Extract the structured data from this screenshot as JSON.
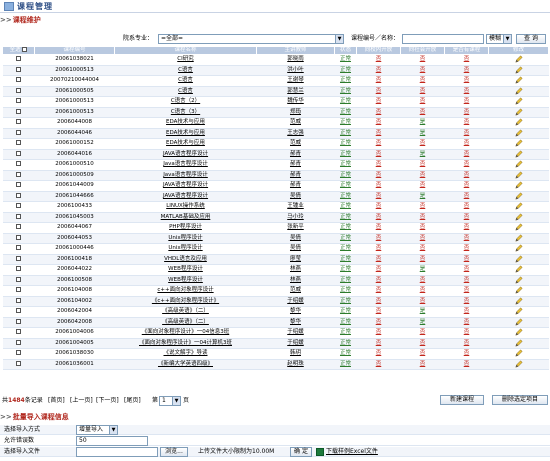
{
  "app_title": "课程管理",
  "section_maintain": "课程维护",
  "filter": {
    "dept_label": "院系专业：",
    "dept_value": "=全部=",
    "search_label": "课程编号／名称：",
    "mode_value": "模糊",
    "search_button": "查 询"
  },
  "table": {
    "headers": [
      "全选",
      "课程编号",
      "课程名称",
      "主讲教师",
      "状态",
      "向校内开放",
      "向社会开放",
      "是否有课程",
      "修改"
    ],
    "rows": [
      {
        "id": "20061038021",
        "name": "CI研究",
        "teacher": "郭晓雨",
        "status": "正常",
        "in": "否",
        "soc": "否",
        "has": "否"
      },
      {
        "id": "20061000513",
        "name": "C语言",
        "teacher": "洪小叶",
        "status": "正常",
        "in": "否",
        "soc": "否",
        "has": "否"
      },
      {
        "id": "20070210044004",
        "name": "C语言",
        "teacher": "王谢琴",
        "status": "正常",
        "in": "否",
        "soc": "否",
        "has": "否"
      },
      {
        "id": "20061000505",
        "name": "C语言",
        "teacher": "郭慧兰",
        "status": "正常",
        "in": "否",
        "soc": "否",
        "has": "否"
      },
      {
        "id": "20061000513",
        "name": "C语言（2）",
        "teacher": "魏传华",
        "status": "正常",
        "in": "否",
        "soc": "否",
        "has": "否"
      },
      {
        "id": "20061000513",
        "name": "C语言（3）",
        "teacher": "郑筠",
        "status": "正常",
        "in": "否",
        "soc": "否",
        "has": "否"
      },
      {
        "id": "2006044008",
        "name": "EDA技术与应用",
        "teacher": "范威",
        "status": "正常",
        "in": "否",
        "soc": "是",
        "has": "否"
      },
      {
        "id": "2006044046",
        "name": "EDA技术与应用",
        "teacher": "王志强",
        "status": "正常",
        "in": "否",
        "soc": "是",
        "has": "否"
      },
      {
        "id": "20061000152",
        "name": "EDA技术与应用",
        "teacher": "范威",
        "status": "正常",
        "in": "否",
        "soc": "否",
        "has": "否"
      },
      {
        "id": "2006044016",
        "name": "JAVA语言程序设计",
        "teacher": "郝青",
        "status": "正常",
        "in": "否",
        "soc": "是",
        "has": "否"
      },
      {
        "id": "20061000510",
        "name": "Java语言程序设计",
        "teacher": "郝青",
        "status": "正常",
        "in": "否",
        "soc": "否",
        "has": "否"
      },
      {
        "id": "20061000509",
        "name": "Java语言程序设计",
        "teacher": "郝青",
        "status": "正常",
        "in": "否",
        "soc": "否",
        "has": "否"
      },
      {
        "id": "20061044009",
        "name": "JAVA语言程序设计",
        "teacher": "郝青",
        "status": "正常",
        "in": "否",
        "soc": "否",
        "has": "否"
      },
      {
        "id": "20061044666",
        "name": "JAVA语言程序设计",
        "teacher": "吴倩",
        "status": "正常",
        "in": "否",
        "soc": "是",
        "has": "否"
      },
      {
        "id": "2006100433",
        "name": "LINUX操作系统",
        "teacher": "王锺业",
        "status": "正常",
        "in": "否",
        "soc": "否",
        "has": "否"
      },
      {
        "id": "20061045003",
        "name": "MATLAB基础及应用",
        "teacher": "马小玲",
        "status": "正常",
        "in": "否",
        "soc": "否",
        "has": "否"
      },
      {
        "id": "2006044067",
        "name": "PHP程序设计",
        "teacher": "张新平",
        "status": "正常",
        "in": "否",
        "soc": "否",
        "has": "否"
      },
      {
        "id": "2006044053",
        "name": "Unix程序设计",
        "teacher": "吴倩",
        "status": "正常",
        "in": "否",
        "soc": "否",
        "has": "否"
      },
      {
        "id": "20061000446",
        "name": "Unix程序设计",
        "teacher": "吴倩",
        "status": "正常",
        "in": "否",
        "soc": "否",
        "has": "否"
      },
      {
        "id": "2006100418",
        "name": "VHDL语言及应用",
        "teacher": "廖莹",
        "status": "正常",
        "in": "否",
        "soc": "否",
        "has": "否"
      },
      {
        "id": "2006044022",
        "name": "WEB程序设计",
        "teacher": "林燕",
        "status": "正常",
        "in": "否",
        "soc": "是",
        "has": "否"
      },
      {
        "id": "2006100508",
        "name": "WEB程序设计",
        "teacher": "林燕",
        "status": "正常",
        "in": "否",
        "soc": "否",
        "has": "否"
      },
      {
        "id": "2006104008",
        "name": "c++面向对象程序设计",
        "teacher": "范威",
        "status": "正常",
        "in": "否",
        "soc": "否",
        "has": "否"
      },
      {
        "id": "2006104002",
        "name": "《c++面向对象程序设计》",
        "teacher": "于绍媛",
        "status": "正常",
        "in": "否",
        "soc": "否",
        "has": "否"
      },
      {
        "id": "2006042004",
        "name": "《高级英语》（二）",
        "teacher": "黎华",
        "status": "正常",
        "in": "否",
        "soc": "是",
        "has": "否"
      },
      {
        "id": "2006042008",
        "name": "《高级英语》（二）",
        "teacher": "黎华",
        "status": "正常",
        "in": "否",
        "soc": "是",
        "has": "否"
      },
      {
        "id": "20061004006",
        "name": "《面向对象程序设计》一04信息3班",
        "teacher": "于绍媛",
        "status": "正常",
        "in": "否",
        "soc": "否",
        "has": "否"
      },
      {
        "id": "20061004005",
        "name": "《面向对象程序设计》一04计算机3班",
        "teacher": "于绍媛",
        "status": "正常",
        "in": "否",
        "soc": "否",
        "has": "否"
      },
      {
        "id": "20061038030",
        "name": "《说文解字》导读",
        "teacher": "韩玥",
        "status": "正常",
        "in": "否",
        "soc": "否",
        "has": "否"
      },
      {
        "id": "20061036001",
        "name": "《新编大学英语四级》",
        "teacher": "赵明珠",
        "status": "正常",
        "in": "否",
        "soc": "否",
        "has": "否"
      }
    ]
  },
  "pager": {
    "prefix": "共",
    "total": "1484",
    "suffix": "条记录",
    "first": "[首页]",
    "prev": "[上一页]",
    "next": "[下一页]",
    "last": "[尾页]",
    "page_prefix": "第",
    "page_value": "1",
    "page_suffix": "页",
    "new_button": "新建课程",
    "delete_button": "删除选定项目"
  },
  "section_import": "批量导入课程信息",
  "import": {
    "mode_label": "选择导入方式",
    "mode_value": "增量导入",
    "errors_label": "允许错误数",
    "errors_value": "50",
    "file_label": "选择导入文件",
    "browse_button": "浏览...",
    "limit_text": "上传文件大小限制为10.00M",
    "confirm_button": "确 定",
    "download_text": "下载样例Excel文件"
  },
  "colors": {
    "accent_red": "#b0261c",
    "header_blue": "#b9c9e0",
    "ok_green": "#2d7c2d"
  }
}
